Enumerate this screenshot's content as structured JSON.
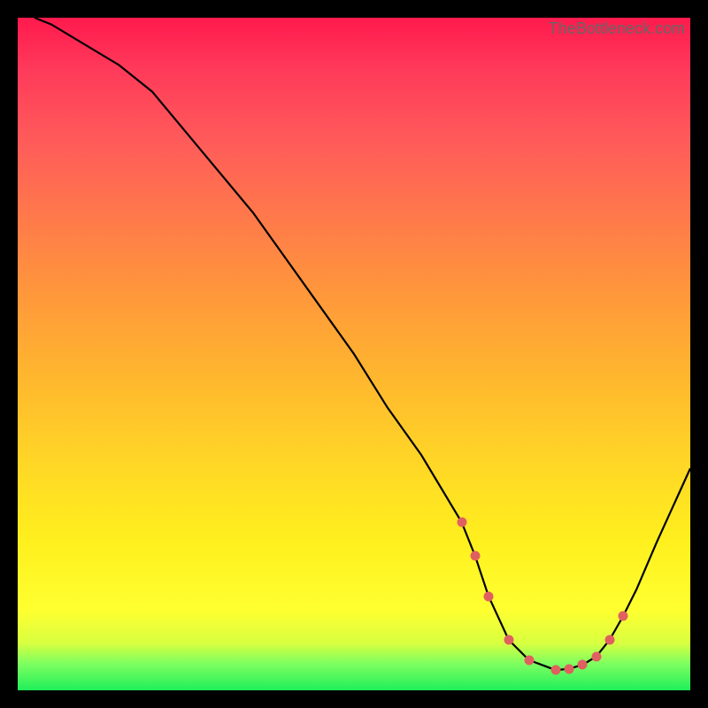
{
  "attribution": "TheBottleneck.com",
  "chart_data": {
    "type": "line",
    "title": "",
    "xlabel": "",
    "ylabel": "",
    "xlim": [
      0,
      100
    ],
    "ylim": [
      0,
      100
    ],
    "background_gradient": [
      "#ff1a4d",
      "#ffff30",
      "#1fef5a"
    ],
    "series": [
      {
        "name": "bottleneck-curve",
        "x": [
          2.5,
          5,
          10,
          15,
          20,
          25,
          30,
          35,
          40,
          45,
          50,
          55,
          60,
          63,
          66,
          68,
          70,
          73,
          76,
          80,
          82,
          84,
          86,
          88,
          90,
          92,
          95,
          100
        ],
        "values": [
          100,
          99,
          96,
          93,
          89,
          83,
          77,
          71,
          64,
          57,
          50,
          42,
          35,
          30,
          25,
          20,
          14,
          7.5,
          4.5,
          3,
          3.2,
          3.8,
          5,
          7.5,
          11,
          15,
          22,
          33
        ]
      }
    ],
    "highlight_points": {
      "name": "marked-points",
      "x": [
        66,
        68,
        70,
        73,
        76,
        80,
        82,
        84,
        86,
        88,
        90
      ],
      "values": [
        25,
        20,
        14,
        7.5,
        4.5,
        3,
        3.2,
        3.8,
        5,
        7.5,
        11
      ]
    }
  }
}
